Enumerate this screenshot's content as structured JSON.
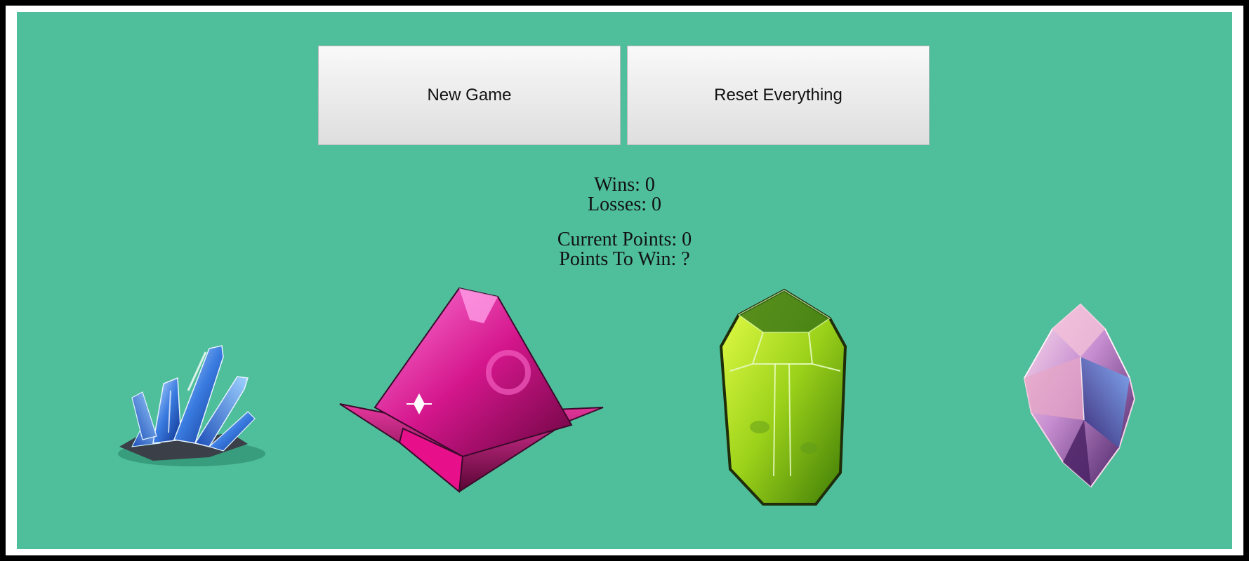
{
  "buttons": {
    "new_game": "New Game",
    "reset_everything": "Reset Everything"
  },
  "record": {
    "wins_label": "Wins: 0",
    "losses_label": "Losses: 0"
  },
  "points": {
    "current_label": "Current Points: 0",
    "to_win_label": "Points To Win: ?"
  },
  "crystals": [
    {
      "name": "blue-crystal-cluster",
      "color": "#2a62c9"
    },
    {
      "name": "pink-crystal",
      "color": "#d81a8c"
    },
    {
      "name": "green-crystal",
      "color": "#8fcf18"
    },
    {
      "name": "iridescent-crystal",
      "color": "#c995c6"
    }
  ],
  "colors": {
    "background": "#4fbe9a",
    "frame": "#ffffff",
    "border": "#000000"
  }
}
